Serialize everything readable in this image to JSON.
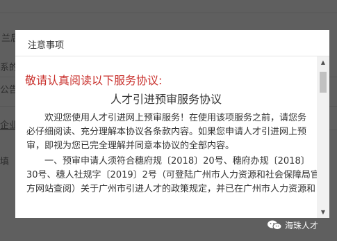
{
  "background": {
    "fragments": [
      "兰后",
      "系的",
      "公告",
      "企业",
      "填"
    ]
  },
  "dialog": {
    "title": "注意事项",
    "warning": "敬请认真阅读以下服务协议:",
    "agreement_title": "人才引进预审服务协议",
    "paragraph1": [
      "欢迎您使用人才引进网上预审服务！在使用该项服务之前，请您务",
      "必仔细阅读、充分理解本协议各条款内容。如果您申请人才引进网上预",
      "审，即视为您已完全理解并同意本协议的全部内容。"
    ],
    "paragraph2": [
      "一、预审申请人须符合穗府规〔2018〕20号、穗府办规〔2018〕",
      "30号、穗人社规字〔2019〕2号（可登陆广州市人力资源和社会保障局官",
      "方网站查阅）关于广州市引进人才的政策规定，并已在广州市人力资源和"
    ]
  },
  "watermark": {
    "text": "海珠人才"
  },
  "icons": {
    "scroll_up": "scroll-up-icon",
    "scroll_down": "scroll-down-icon",
    "watermark_logo": "wechat-icon"
  },
  "colors": {
    "warning": "#c9302c",
    "overlay": "#5f5f5f"
  }
}
